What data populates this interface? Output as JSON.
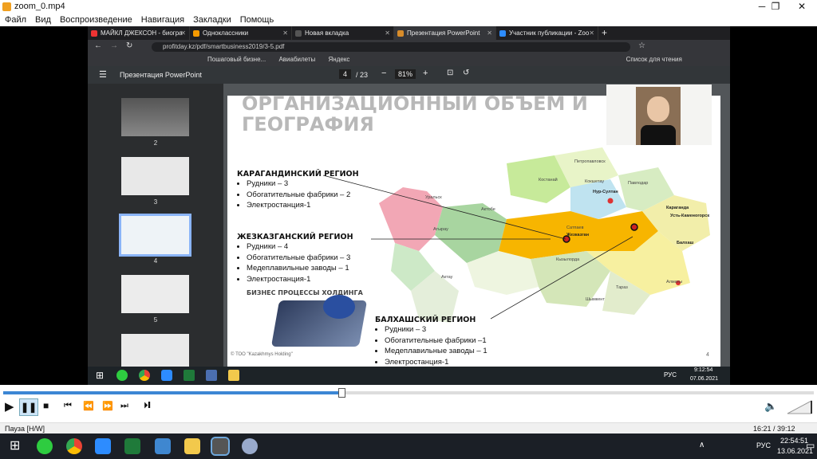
{
  "window": {
    "title": "zoom_0.mp4",
    "controls": [
      "─",
      "❐",
      "✕"
    ]
  },
  "menu": [
    "Файл",
    "Вид",
    "Воспроизведение",
    "Навигация",
    "Закладки",
    "Помощь"
  ],
  "chrome": {
    "tabs": [
      {
        "label": "МАЙКЛ ДЖЕКСОН - биогра",
        "color": "#e33"
      },
      {
        "label": "Одноклассники",
        "color": "#f59a00"
      },
      {
        "label": "Новая вкладка",
        "color": "#555"
      },
      {
        "label": "Презентация PowerPoint",
        "color": "#d88c2a"
      },
      {
        "label": "Участник публикации - Zoo",
        "color": "#2d8cff"
      }
    ],
    "address": "profitday.kz/pdf/smartbusiness2019/3-5.pdf",
    "bookmarks": [
      "Пошаговый бизне...",
      "Авиабилеты",
      "Яндекс",
      "Список для чтения"
    ]
  },
  "pdf": {
    "title": "Презентация PowerPoint",
    "page": "4",
    "total": "/ 23",
    "zoom": "81%"
  },
  "thumbs": [
    {
      "num": "2"
    },
    {
      "num": "3"
    },
    {
      "num": "4"
    },
    {
      "num": "5"
    }
  ],
  "slide": {
    "title_line1": "ОРГАНИЗАЦИОННЫЙ ОБЪЕМ И",
    "title_line2": "ГЕОГРАФИЯ",
    "karaganda": {
      "title": "КАРАГАНДИНСКИЙ РЕГИОН",
      "items": [
        "Рудники – 3",
        "Обогатительные фабрики – 2",
        "Электростанция-1"
      ]
    },
    "zhezkazgan": {
      "title": "ЖЕЗКАЗГАНСКИЙ РЕГИОН",
      "items": [
        "Рудники – 4",
        "Обогатительные фабрики – 3",
        "Медеплавильные заводы – 1",
        "Электростанция-1"
      ]
    },
    "balkhash": {
      "title": "БАЛХАШСКИЙ РЕГИОН",
      "items": [
        "Рудники – 3",
        "Обогатительные фабрики –1",
        "Медеплавильные заводы – 1",
        "Электростанция-1"
      ]
    },
    "biz_title": "БИЗНЕС ПРОЦЕССЫ ХОЛДИНГА",
    "copyright": "© ТОО \"Kazakhmys Holding\"",
    "page_num": "4",
    "map_labels": {
      "nursultan": "Нур-Султан",
      "karaganda": "Караганда",
      "zhezkazgan": "Жезказган",
      "balkhash": "Балхаш",
      "ustkam": "Усть-Каменогорск",
      "petropavl": "Петропавловск",
      "kostanay": "Костанай",
      "kokshetau": "Кокшетау",
      "pavlodar": "Павлодар",
      "uralsk": "Уральск",
      "aktobe": "Актобе",
      "atyrau": "Атырау",
      "aktau": "Актау",
      "kyzylorda": "Кызылорда",
      "shymkent": "Шымкент",
      "taraz": "Тараз",
      "almaty": "Алматы",
      "satpaev": "Сатпаев"
    }
  },
  "inner_taskbar": {
    "time": "9:12:54",
    "date": "07.06.2021",
    "lang": "РУС"
  },
  "player": {
    "status": "Пауза [H/W]",
    "time": "16:21 / 39:12",
    "progress": 0.417
  },
  "taskbar": {
    "time": "22:54:51",
    "date": "13.06.2021",
    "lang": "РУС"
  }
}
